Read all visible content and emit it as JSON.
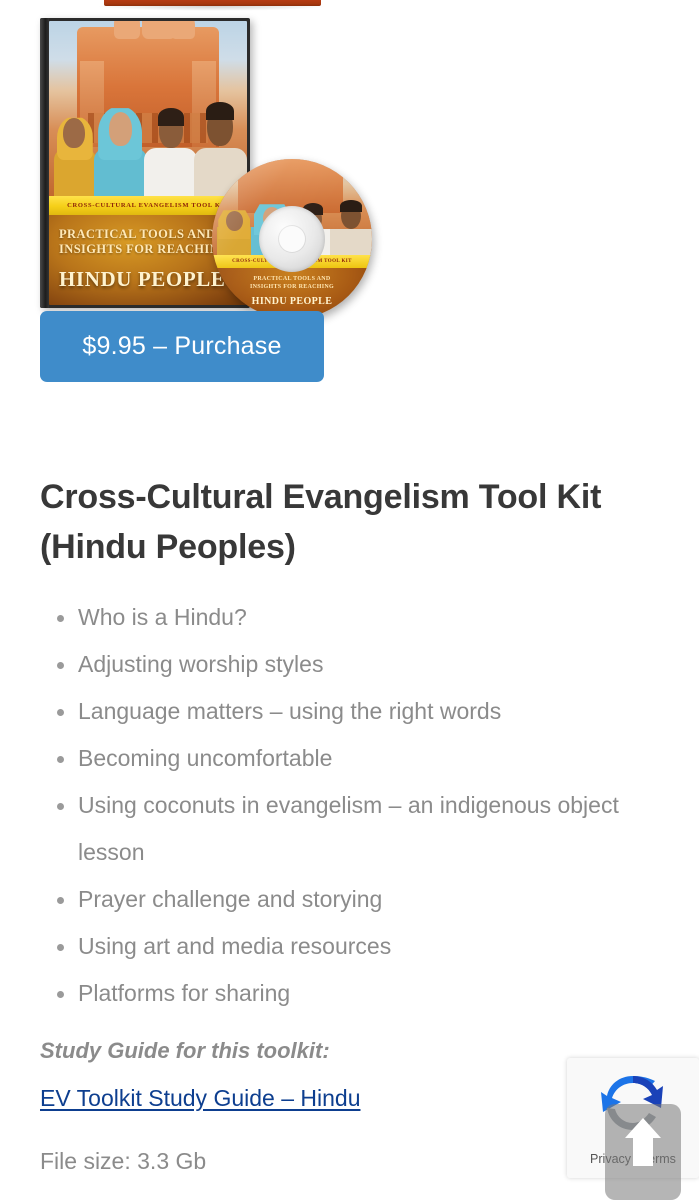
{
  "product": {
    "image_alt": "Cross-Cultural Evangelism Tool Kit DVD case and disc",
    "case_band_text": "CROSS-CULTURAL EVANGELISM TOOL KIT",
    "case_line1": "PRACTICAL TOOLS AND",
    "case_line2": "INSIGHTS FOR REACHING",
    "case_headline": "HINDU PEOPLE",
    "disc_band_text": "CROSS-CULTURAL EVANGELISM TOOL KIT",
    "disc_line1": "PRACTICAL TOOLS AND",
    "disc_line2": "INSIGHTS FOR REACHING",
    "disc_headline": "HINDU PEOPLE"
  },
  "purchase": {
    "label": "$9.95 – Purchase",
    "price": "$9.95",
    "color": "#3f8cca"
  },
  "title": "Cross-Cultural Evangelism Tool Kit (Hindu Peoples)",
  "features": [
    "Who is a Hindu?",
    "Adjusting worship styles",
    "Language matters – using the right words",
    "Becoming uncomfortable",
    "Using coconuts in evangelism – an indigenous object lesson",
    "Prayer challenge and storying",
    "Using art and media resources",
    "Platforms for sharing"
  ],
  "study_guide": {
    "label": "Study Guide for this toolkit:",
    "link_text": "EV Toolkit Study Guide – Hindu",
    "link_color": "#0d3e8f"
  },
  "file_size": "File size: 3.3 Gb",
  "recaptcha": {
    "privacy_terms": "Privacy - Terms",
    "logo_name": "recaptcha-logo"
  },
  "scroll_top": {
    "icon": "arrow-up-icon"
  }
}
